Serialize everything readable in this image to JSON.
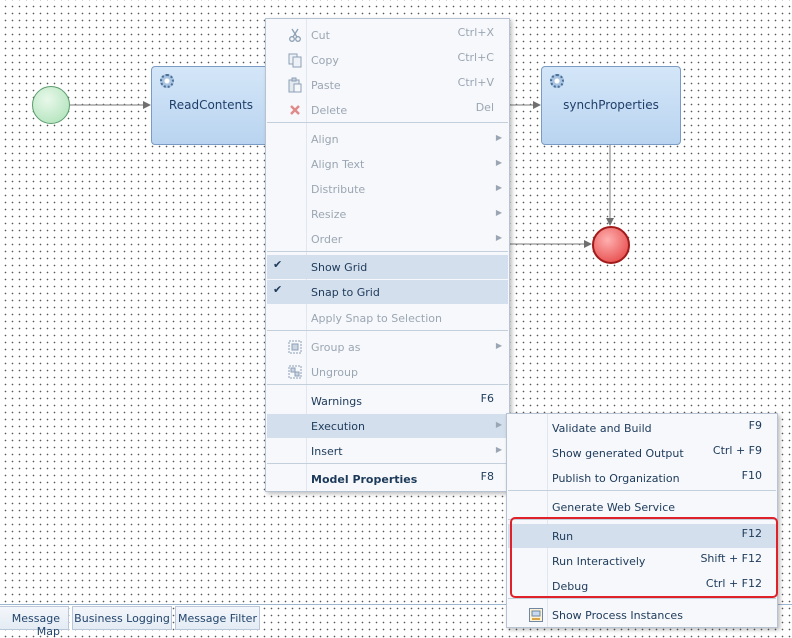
{
  "diagram": {
    "tasks": [
      {
        "label": "ReadContents"
      },
      {
        "label": "synchProperties"
      }
    ]
  },
  "context_menu": {
    "items": [
      {
        "label": "Cut",
        "shortcut": "Ctrl+X",
        "icon": "scissors-icon",
        "disabled": true
      },
      {
        "label": "Copy",
        "shortcut": "Ctrl+C",
        "icon": "copy-icon",
        "disabled": true
      },
      {
        "label": "Paste",
        "shortcut": "Ctrl+V",
        "icon": "paste-icon",
        "disabled": true
      },
      {
        "label": "Delete",
        "shortcut": "Del",
        "icon": "delete-icon",
        "disabled": true
      },
      {
        "label": "Align",
        "disabled": true,
        "submenu": true
      },
      {
        "label": "Align Text",
        "disabled": true,
        "submenu": true
      },
      {
        "label": "Distribute",
        "disabled": true,
        "submenu": true
      },
      {
        "label": "Resize",
        "disabled": true,
        "submenu": true
      },
      {
        "label": "Order",
        "disabled": true,
        "submenu": true
      },
      {
        "label": "Show Grid",
        "checked": true
      },
      {
        "label": "Snap to Grid",
        "checked": true
      },
      {
        "label": "Apply Snap to Selection",
        "disabled": true
      },
      {
        "label": "Group as",
        "icon": "group-icon",
        "disabled": true,
        "submenu": true
      },
      {
        "label": "Ungroup",
        "icon": "ungroup-icon",
        "disabled": true
      },
      {
        "label": "Warnings",
        "shortcut": "F6"
      },
      {
        "label": "Execution",
        "submenu": true,
        "highlighted": true
      },
      {
        "label": "Insert",
        "submenu": true
      },
      {
        "label": "Model Properties",
        "shortcut": "F8",
        "bold": true
      }
    ]
  },
  "execution_submenu": {
    "items": [
      {
        "label": "Validate and Build",
        "shortcut": "F9"
      },
      {
        "label": "Show generated Output",
        "shortcut": "Ctrl + F9"
      },
      {
        "label": "Publish to Organization",
        "shortcut": "F10"
      },
      {
        "label": "Generate Web Service"
      },
      {
        "label": "Run",
        "shortcut": "F12",
        "highlighted": true
      },
      {
        "label": "Run Interactively",
        "shortcut": "Shift + F12"
      },
      {
        "label": "Debug",
        "shortcut": "Ctrl + F12"
      },
      {
        "label": "Show Process Instances",
        "icon": "process-instances-icon"
      }
    ]
  },
  "bottom_tabs": [
    {
      "label": "Message Map"
    },
    {
      "label": "Business Logging"
    },
    {
      "label": "Message Filter"
    }
  ],
  "colors": {
    "highlight_box": "#e0212a",
    "menu_selected": "#d3dfec",
    "start_event": "#a8e0b4",
    "end_event": "#e23a3a"
  }
}
